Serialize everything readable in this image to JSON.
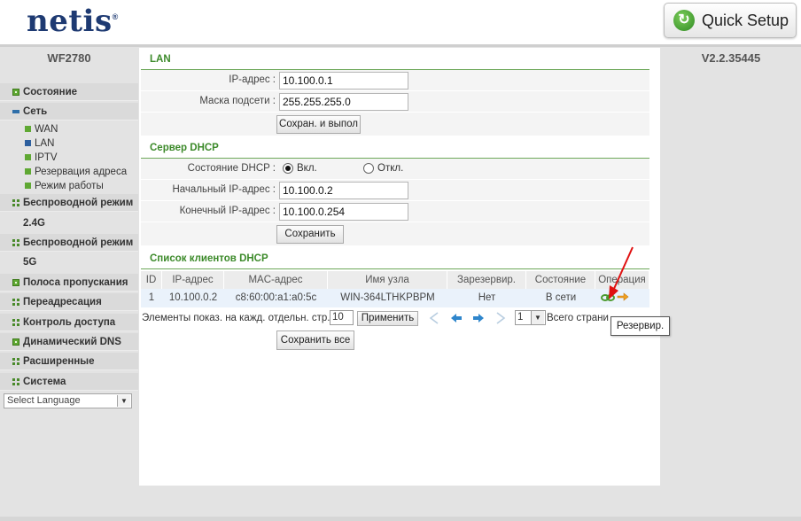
{
  "header": {
    "logo_text": "netis",
    "logo_mark": "®",
    "quick_setup_label": "Quick Setup",
    "quick_setup_icon": "refresh-arrow-icon"
  },
  "sidebar": {
    "model": "WF2780",
    "items": [
      {
        "label": "Состояние",
        "icon": "square-icon"
      },
      {
        "label": "Сеть",
        "icon": "minus-icon"
      },
      {
        "label": "Беспроводной режим",
        "icon": "grid-icon"
      },
      {
        "label": "2.4G"
      },
      {
        "label": "Беспроводной режим",
        "icon": "grid-icon"
      },
      {
        "label": "5G"
      },
      {
        "label": "Полоса пропускания",
        "icon": "square-icon"
      },
      {
        "label": "Переадресация",
        "icon": "grid-icon"
      },
      {
        "label": "Контроль доступа",
        "icon": "grid-icon"
      },
      {
        "label": "Динамический DNS",
        "icon": "square-icon"
      },
      {
        "label": "Расширенные",
        "icon": "grid-icon"
      },
      {
        "label": "Система",
        "icon": "grid-icon"
      }
    ],
    "subitems": [
      "WAN",
      "LAN",
      "IPTV",
      "Резервация адреса",
      "Режим работы"
    ],
    "language": "Select Language"
  },
  "firmware_version": "V2.2.35445",
  "lan": {
    "title": "LAN",
    "ip_label": "IP-адрес :",
    "ip_value": "10.100.0.1",
    "mask_label": "Маска подсети :",
    "mask_value": "255.255.255.0",
    "save_button": "Сохран. и выпол"
  },
  "dhcp": {
    "title": "Сервер DHCP",
    "state_label": "Состояние DHCP :",
    "on_label": "Вкл.",
    "off_label": "Откл.",
    "state": "on",
    "start_label": "Начальный IP-адрес :",
    "start_value": "10.100.0.2",
    "end_label": "Конечный IP-адрес :",
    "end_value": "10.100.0.254",
    "save_button": "Сохранить"
  },
  "clients": {
    "title": "Список клиентов DHCP",
    "columns": [
      "ID",
      "IP-адрес",
      "MAC-адрес",
      "Имя узла",
      "Зарезервир.",
      "Состояние",
      "Операция"
    ],
    "rows": [
      {
        "id": "1",
        "ip": "10.100.0.2",
        "mac": "c8:60:00:a1:a0:5c",
        "host": "WIN-364LTHKPBPM",
        "reserved": "Нет",
        "state": "В сети"
      }
    ],
    "pagination": {
      "per_page_label": "Элементы показ. на кажд. отдельн. стр.",
      "per_page_value": "10",
      "apply_button": "Применить",
      "page_value": "1",
      "total_label": "Всего страни"
    },
    "save_all_button": "Сохранить все",
    "tooltip": "Резервир.",
    "accent_color": "#3c8a2a"
  }
}
